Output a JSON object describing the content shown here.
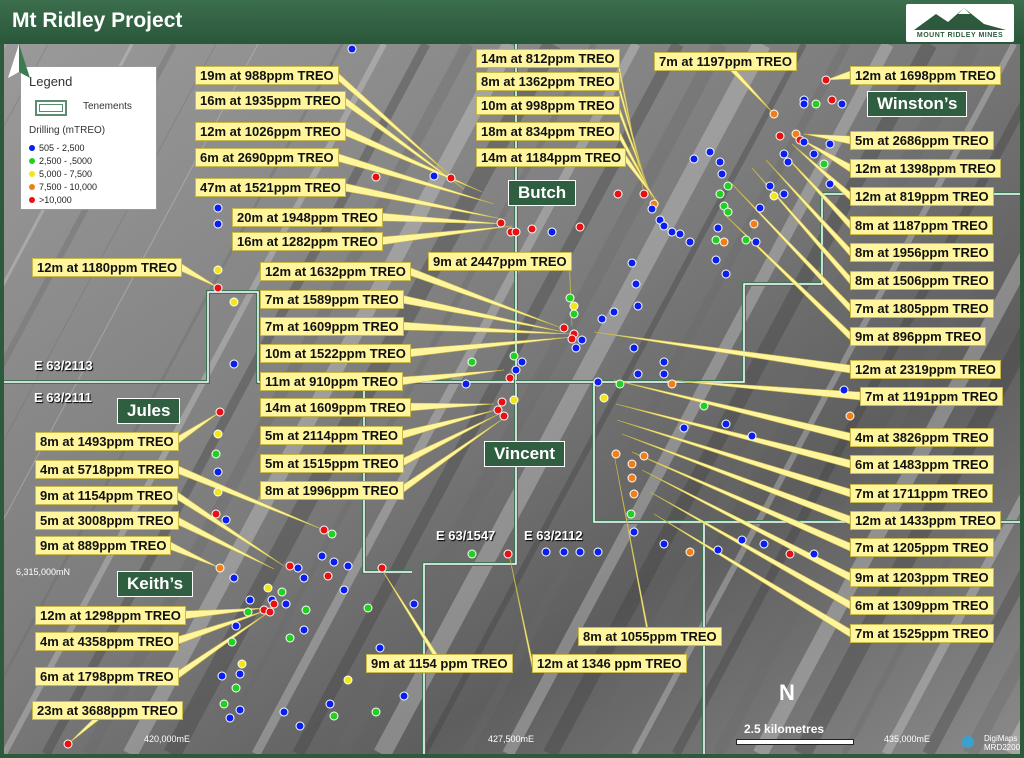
{
  "title": "Mt Ridley Project",
  "logo": "MOUNT RIDLEY MINES",
  "legend": {
    "title": "Legend",
    "tenements": "Tenements",
    "drilling": "Drilling (mTREO)",
    "classes": [
      {
        "label": "505 - 2,500",
        "color": "#0a1ef0"
      },
      {
        "label": "2,500 - ,5000",
        "color": "#22d022"
      },
      {
        "label": "5,000 - 7,500",
        "color": "#f2e61a"
      },
      {
        "label": "7,500 - 10,000",
        "color": "#f07f1a"
      },
      {
        "label": ">10,000",
        "color": "#e81010"
      }
    ]
  },
  "prospects": [
    "Butch",
    "Winston’s",
    "Jules",
    "Vincent",
    "Keith’s"
  ],
  "tenements": [
    "E 63/2113",
    "E 63/2111",
    "E 63/1547",
    "E 63/2112"
  ],
  "coords": [
    "420,000mE",
    "427,500mE",
    "435,000mE",
    "6,315,000mN"
  ],
  "scale": "2.5 kilometres",
  "north": "N",
  "credit": [
    "DigiMaps",
    "MRD22006"
  ],
  "intercepts": [
    "19m at 988ppm TREO",
    "16m at 1935ppm TREO",
    "12m at 1026ppm TREO",
    "6m at 2690ppm TREO",
    "47m at 1521ppm TREO",
    "20m at 1948ppm TREO",
    "16m at 1282ppm TREO",
    "12m at 1180ppm TREO",
    "12m at 1632ppm TREO",
    "7m at 1589ppm TREO",
    "7m at 1609ppm TREO",
    "10m at 1522ppm TREO",
    "11m at 910ppm TREO",
    "14m at 1609ppm TREO",
    "5m at 2114ppm TREO",
    "5m at 1515ppm TREO",
    "8m at 1996ppm TREO",
    "8m at 1493ppm TREO",
    "4m at 5718ppm TREO",
    "9m at 1154ppm TREO",
    "5m at 3008ppm TREO",
    "9m at 889ppm TREO",
    "12m at 1298ppm TREO",
    "4m at 4358ppm TREO",
    "6m at 1798ppm TREO",
    "23m at 3688ppm TREO",
    "9m at 1154 ppm TREO",
    "12m at 1346 ppm TREO",
    "8m at 1055ppm TREO",
    "9m at 2447ppm TREO",
    "14m at 812ppm TREO",
    "8m at 1362ppm TREO",
    "10m at 998ppm TREO",
    "18m at 834ppm TREO",
    "14m at 1184ppm TREO",
    "7m at 1197ppm TREO",
    "12m at 1698ppm TREO",
    "5m at 2686ppm TREO",
    "12m at 1398ppm TREO",
    "12m at 819ppm TREO",
    "8m at 1187ppm TREO",
    "8m at 1956ppm TREO",
    "8m at 1506ppm TREO",
    "7m at 1805ppm TREO",
    "9m at 896ppm TREO",
    "12m at 2319ppm TREO",
    "7m at 1191ppm TREO",
    "4m at 3826ppm TREO",
    "6m at 1483ppm TREO",
    "7m at 1711ppm TREO",
    "12m at 1433ppm TREO",
    "7m at 1205ppm TREO",
    "9m at 1203ppm TREO",
    "6m at 1309ppm TREO",
    "7m at 1525ppm TREO"
  ]
}
